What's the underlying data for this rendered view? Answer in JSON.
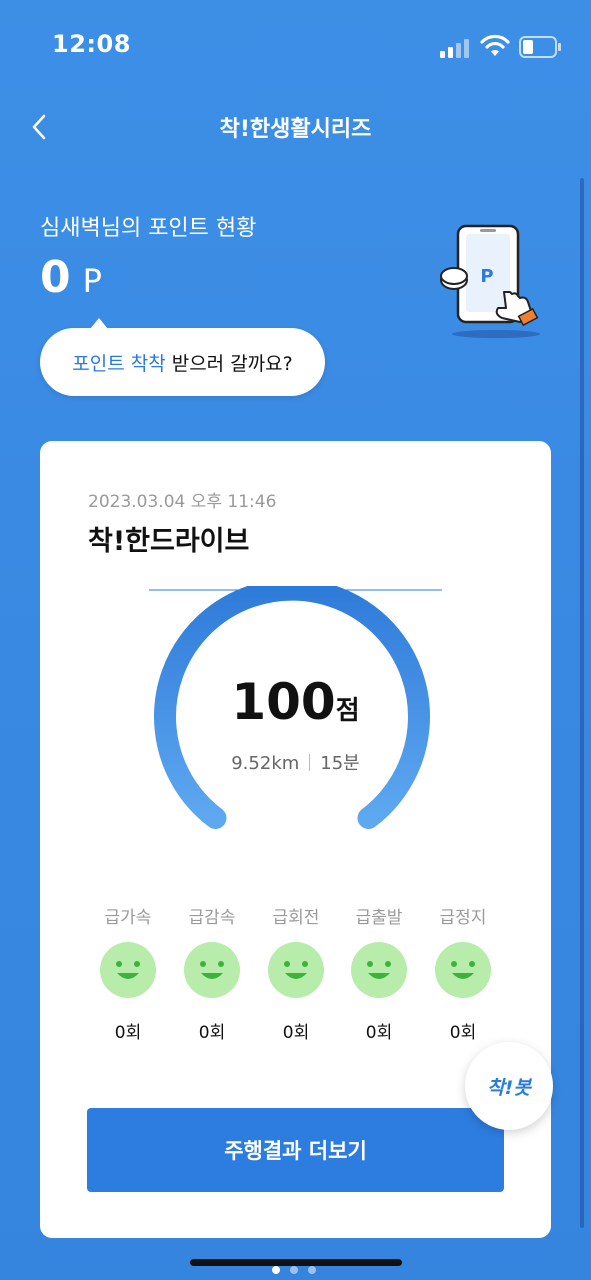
{
  "status_bar": {
    "time": "12:08"
  },
  "nav": {
    "title": "착!한생활시리즈"
  },
  "points": {
    "label": "심새벽님의 포인트 현황",
    "value": "0",
    "unit": "P",
    "illustration_letter": "P"
  },
  "bubble": {
    "highlight": "포인트 착착",
    "text": "받으러 갈까요?"
  },
  "card": {
    "date": "2023.03.04 오후 11:46",
    "title": "착!한드라이브",
    "score_value": "100",
    "score_unit": "점",
    "distance": "9.52km",
    "duration": "15분",
    "metrics": [
      {
        "label": "급가속",
        "count": "0회"
      },
      {
        "label": "급감속",
        "count": "0회"
      },
      {
        "label": "급회전",
        "count": "0회"
      },
      {
        "label": "급출발",
        "count": "0회"
      },
      {
        "label": "급정지",
        "count": "0회"
      }
    ],
    "more_button": "주행결과 더보기"
  },
  "bot_button": "착!봇",
  "colors": {
    "accent": "#2d7de0",
    "background": "#3a8ae3",
    "face": "#b8ecab",
    "face_feature": "#3db33d"
  }
}
